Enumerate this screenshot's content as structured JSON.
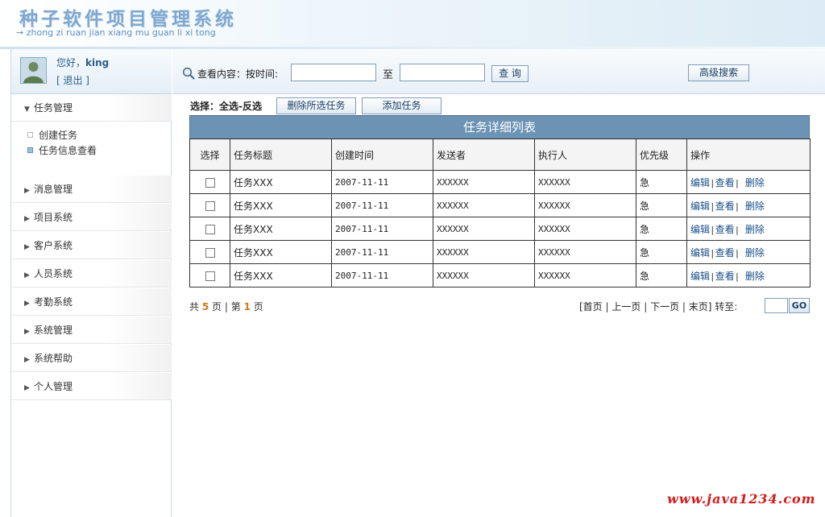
{
  "header": {
    "title": "种子软件项目管理系统",
    "subtitle": "→ zhong zi ruan jian xiang mu guan li xi tong"
  },
  "user": {
    "greeting": "您好，",
    "name": "king",
    "logout": "[ 退出 ]"
  },
  "sidebar": {
    "groups": [
      {
        "label": "任务管理",
        "expanded": true,
        "items": [
          {
            "label": "创建任务",
            "active": false
          },
          {
            "label": "任务信息查看",
            "active": true
          }
        ]
      },
      {
        "label": "消息管理"
      },
      {
        "label": "项目系统"
      },
      {
        "label": "客户系统"
      },
      {
        "label": "人员系统"
      },
      {
        "label": "考勤系统"
      },
      {
        "label": "系统管理"
      },
      {
        "label": "系统帮助"
      },
      {
        "label": "个人管理"
      }
    ]
  },
  "search": {
    "label": "查看内容：按时间:",
    "to_label": "至",
    "start_value": "",
    "end_value": "",
    "query_button": "查 询",
    "advanced_button": "高级搜索"
  },
  "actions": {
    "select_prefix": "选择：",
    "select_all": "全选",
    "dash": "-",
    "invert": "反选",
    "delete_selected": "删除所选任务",
    "add_task": "添加任务"
  },
  "table": {
    "caption": "任务详细列表",
    "headers": [
      "选择",
      "任务标题",
      "创建时间",
      "发送者",
      "执行人",
      "优先级",
      "操作"
    ],
    "rows": [
      {
        "title": "任务XXX",
        "created": "2007-11-11",
        "sender": "XXXXXX",
        "executor": "XXXXXX",
        "priority": "急"
      },
      {
        "title": "任务XXX",
        "created": "2007-11-11",
        "sender": "XXXXXX",
        "executor": "XXXXXX",
        "priority": "急"
      },
      {
        "title": "任务XXX",
        "created": "2007-11-11",
        "sender": "XXXXXX",
        "executor": "XXXXXX",
        "priority": "急"
      },
      {
        "title": "任务XXX",
        "created": "2007-11-11",
        "sender": "XXXXXX",
        "executor": "XXXXXX",
        "priority": "急"
      },
      {
        "title": "任务XXX",
        "created": "2007-11-11",
        "sender": "XXXXXX",
        "executor": "XXXXXX",
        "priority": "急"
      }
    ],
    "ops": {
      "edit": "编辑",
      "view": "查看",
      "delete": "删除"
    }
  },
  "pager": {
    "total_prefix": "共",
    "total_pages": "5",
    "total_suffix": "页",
    "divider": "|",
    "current_prefix": "第",
    "current_page": "1",
    "current_suffix": "页",
    "first": "[首页",
    "prev": "上一页",
    "next": "下一页",
    "last": "末页]",
    "goto_label": "转至:",
    "goto_value": "",
    "go_button": "GO"
  },
  "watermark": "www.java1234.com",
  "colors": {
    "caption_bg": "#6c93b4",
    "link": "#1b4f8a",
    "page_number": "#d27a18",
    "watermark": "#d41a1a"
  }
}
